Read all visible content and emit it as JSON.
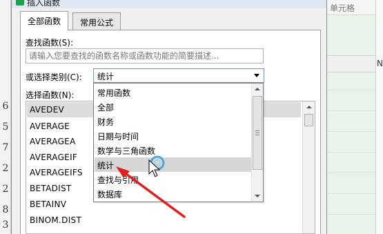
{
  "background": {
    "row_numbers": [
      "6",
      "5",
      "7",
      "2",
      "2",
      "8",
      "3"
    ],
    "cell_label": "单元格",
    "column_header": "N"
  },
  "dialog": {
    "title": "插入函数",
    "tabs": [
      {
        "label": "全部函数",
        "active": true
      },
      {
        "label": "常用公式",
        "active": false
      }
    ],
    "search_label": "查找函数(S):",
    "search_placeholder": "请输入您要查找的函数名称或函数功能的简要描述...",
    "category_label": "或选择类别(C):",
    "category_value": "统计",
    "functions_label": "选择函数(N):",
    "functions": [
      "AVEDEV",
      "AVERAGE",
      "AVERAGEA",
      "AVERAGEIF",
      "AVERAGEIFS",
      "BETADIST",
      "BETAINV",
      "BINOM.DIST"
    ],
    "selected_function_index": 0
  },
  "dropdown": {
    "options": [
      "常用函数",
      "全部",
      "财务",
      "日期与时间",
      "数学与三角函数",
      "统计",
      "查找与引用",
      "数据库"
    ],
    "selected_index": 5
  },
  "colors": {
    "accent_border": "#5b9bd5",
    "annotation_arrow": "#e02020",
    "selection_bg": "#d6d6d6"
  }
}
